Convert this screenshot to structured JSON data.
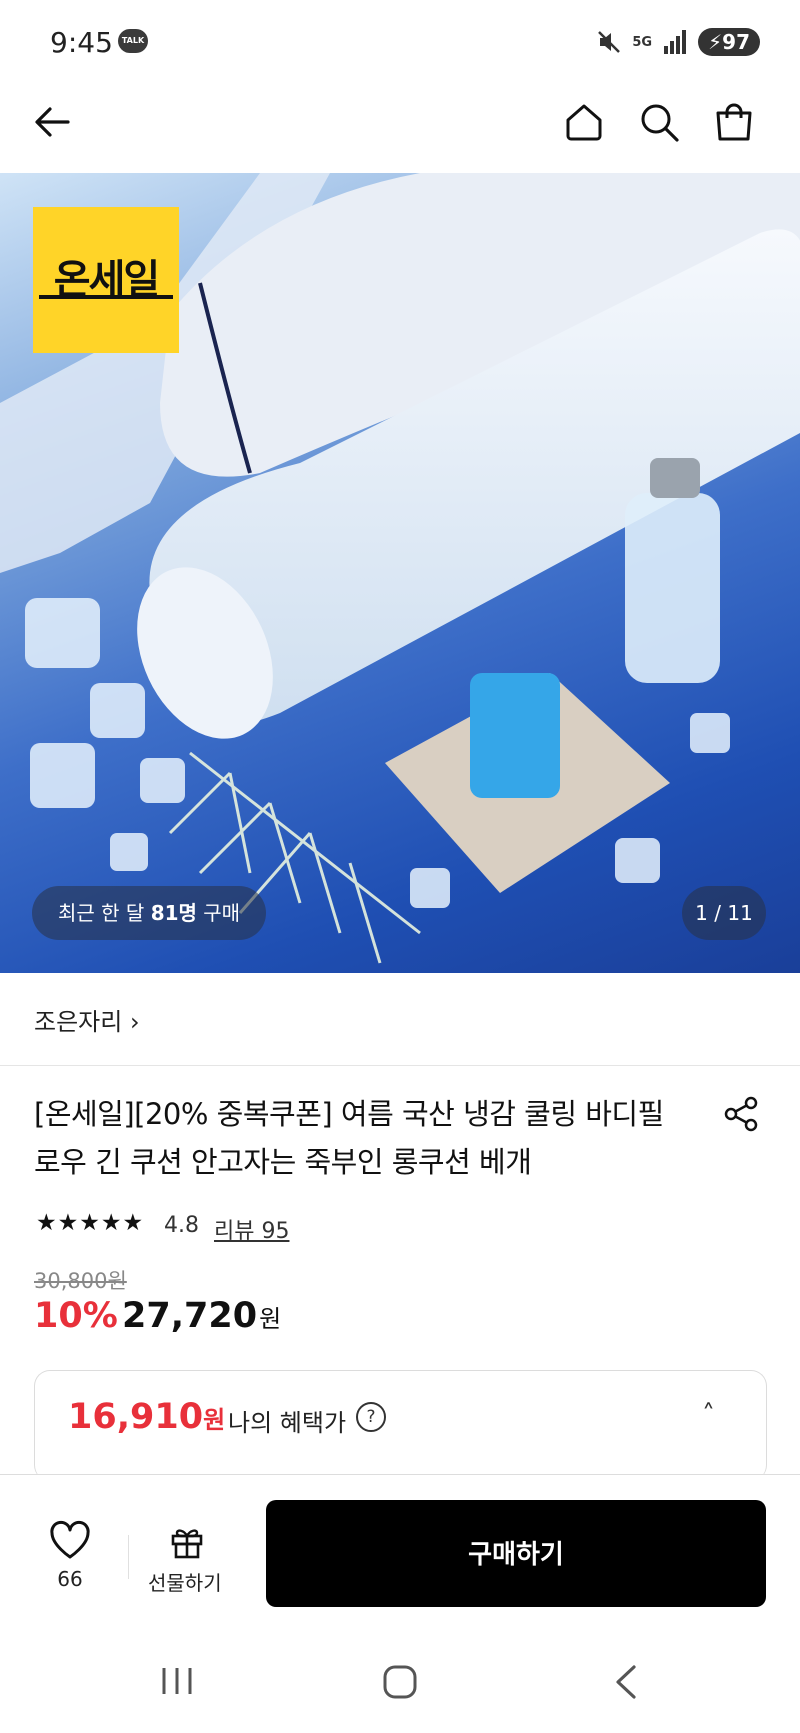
{
  "status_bar": {
    "time": "9:45",
    "talk_badge": "TALK",
    "network": "5G",
    "battery": "97"
  },
  "header": {
    "back_icon": "arrow-left-icon",
    "home_icon": "home-icon",
    "search_icon": "search-icon",
    "cart_icon": "shopping-bag-icon"
  },
  "hero": {
    "badge_text": "온세일",
    "recent_prefix": "최근 한 달 ",
    "recent_count": "81명",
    "recent_suffix": " 구매",
    "page_indicator": "1 / 11"
  },
  "seller": {
    "name": "조은자리",
    "chevron": "›"
  },
  "product": {
    "title": "[온세일][20% 중복쿠폰] 여름 국산 냉감 쿨링 바디필로우 긴 쿠션 안고자는 죽부인 롱쿠션 베개",
    "stars": "★★★★★",
    "rating": "4.8",
    "review_label": "리뷰 95",
    "original_price": "30,800원",
    "discount_rate": "10%",
    "sale_price": "27,720",
    "currency": "원"
  },
  "benefit": {
    "price": "16,910",
    "currency": "원",
    "label": "나의 혜택가",
    "help_glyph": "?",
    "caret": "˄"
  },
  "bottom_bar": {
    "like_count": "66",
    "gift_label": "선물하기",
    "buy_label": "구매하기"
  },
  "colors": {
    "accent_red": "#e8303a",
    "badge_yellow": "#ffd428",
    "buy_button": "#000000"
  }
}
